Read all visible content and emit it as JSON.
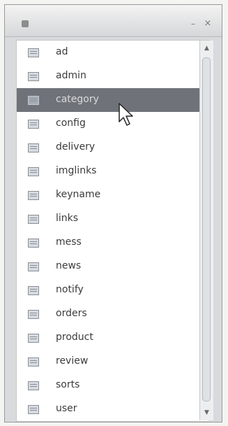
{
  "titlebar": {
    "minimize_icon": "minimize-icon",
    "close_icon": "close-icon",
    "min_glyph": "–",
    "close_glyph": "×"
  },
  "list": {
    "selected_index": 2,
    "items": [
      {
        "label": "ad",
        "icon": "table-icon"
      },
      {
        "label": "admin",
        "icon": "table-icon"
      },
      {
        "label": "category",
        "icon": "table-icon"
      },
      {
        "label": "config",
        "icon": "table-icon"
      },
      {
        "label": "delivery",
        "icon": "table-icon"
      },
      {
        "label": "imglinks",
        "icon": "table-icon"
      },
      {
        "label": "keyname",
        "icon": "table-icon"
      },
      {
        "label": "links",
        "icon": "table-icon"
      },
      {
        "label": "mess",
        "icon": "table-icon"
      },
      {
        "label": "news",
        "icon": "table-icon"
      },
      {
        "label": "notify",
        "icon": "table-icon"
      },
      {
        "label": "orders",
        "icon": "table-icon"
      },
      {
        "label": "product",
        "icon": "table-icon"
      },
      {
        "label": "review",
        "icon": "table-icon"
      },
      {
        "label": "sorts",
        "icon": "table-icon"
      },
      {
        "label": "user",
        "icon": "table-icon"
      }
    ]
  },
  "scrollbar": {
    "up_glyph": "▲",
    "down_glyph": "▼"
  },
  "colors": {
    "selected_row": "#6f7379",
    "window_bg": "#d8dadd"
  }
}
